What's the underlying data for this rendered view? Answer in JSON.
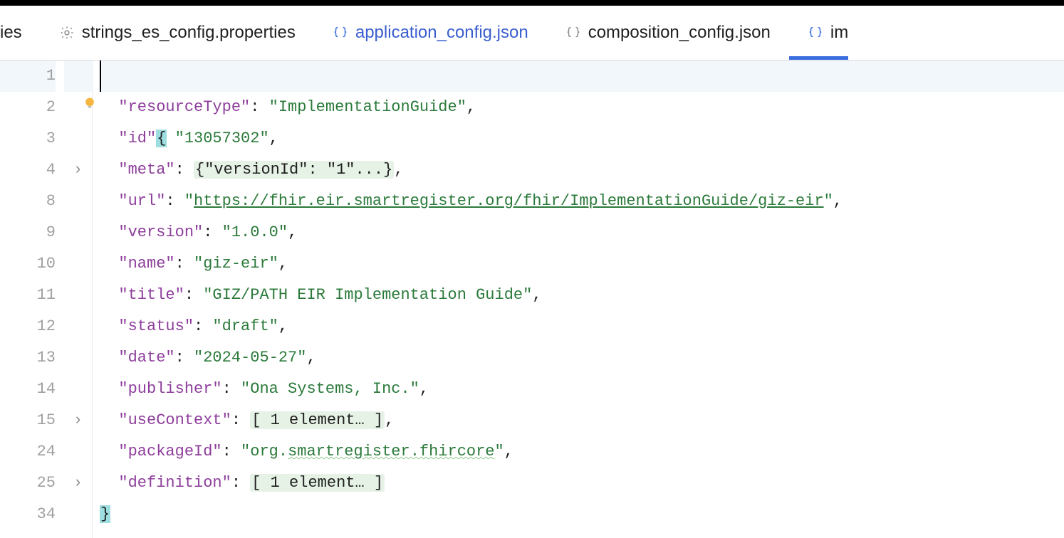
{
  "tabs": {
    "partial_left": "ies",
    "t1": "strings_es_config.properties",
    "t2": "application_config.json",
    "t3": "composition_config.json",
    "t4": "im"
  },
  "gutter": [
    "1",
    "2",
    "3",
    "4",
    "8",
    "9",
    "10",
    "11",
    "12",
    "13",
    "14",
    "15",
    "24",
    "25",
    "34"
  ],
  "fold": [
    "",
    "",
    "",
    "›",
    "",
    "",
    "",
    "",
    "",
    "",
    "",
    "›",
    "",
    "›",
    ""
  ],
  "code": {
    "l1_open": "{",
    "l2": {
      "indent": "  ",
      "key": "\"resourceType\"",
      "sep": ": ",
      "val": "\"ImplementationGuide\"",
      "tail": ","
    },
    "l3": {
      "indent": "  ",
      "key": "\"id\"",
      "sep": ": ",
      "val": "\"13057302\"",
      "tail": ","
    },
    "l4": {
      "indent": "  ",
      "key": "\"meta\"",
      "sep": ": ",
      "blob": "{\"versionId\": \"1\"...}",
      "tail": ","
    },
    "l8": {
      "indent": "  ",
      "key": "\"url\"",
      "sep": ": ",
      "q": "\"",
      "url": "https://fhir.eir.smartregister.org/fhir/ImplementationGuide/giz-eir",
      "tail": ","
    },
    "l9": {
      "indent": "  ",
      "key": "\"version\"",
      "sep": ": ",
      "val": "\"1.0.0\"",
      "tail": ","
    },
    "l10": {
      "indent": "  ",
      "key": "\"name\"",
      "sep": ": ",
      "val": "\"giz-eir\"",
      "tail": ","
    },
    "l11": {
      "indent": "  ",
      "key": "\"title\"",
      "sep": ": ",
      "val": "\"GIZ/PATH EIR Implementation Guide\"",
      "tail": ","
    },
    "l12": {
      "indent": "  ",
      "key": "\"status\"",
      "sep": ": ",
      "val": "\"draft\"",
      "tail": ","
    },
    "l13": {
      "indent": "  ",
      "key": "\"date\"",
      "sep": ": ",
      "val": "\"2024-05-27\"",
      "tail": ","
    },
    "l14": {
      "indent": "  ",
      "key": "\"publisher\"",
      "sep": ": ",
      "val": "\"Ona Systems, Inc.\"",
      "tail": ","
    },
    "l15": {
      "indent": "  ",
      "key": "\"useContext\"",
      "sep": ": ",
      "blob": "[ 1 element… ]",
      "tail": ","
    },
    "l24": {
      "indent": "  ",
      "key": "\"packageId\"",
      "sep": ": ",
      "q": "\"",
      "plain1": "org.",
      "wavy": "smartregister.fhircore",
      "tail": ","
    },
    "l25": {
      "indent": "  ",
      "key": "\"definition\"",
      "sep": ": ",
      "blob": "[ 1 element… ]",
      "tail": ""
    },
    "l34_close": "}"
  }
}
